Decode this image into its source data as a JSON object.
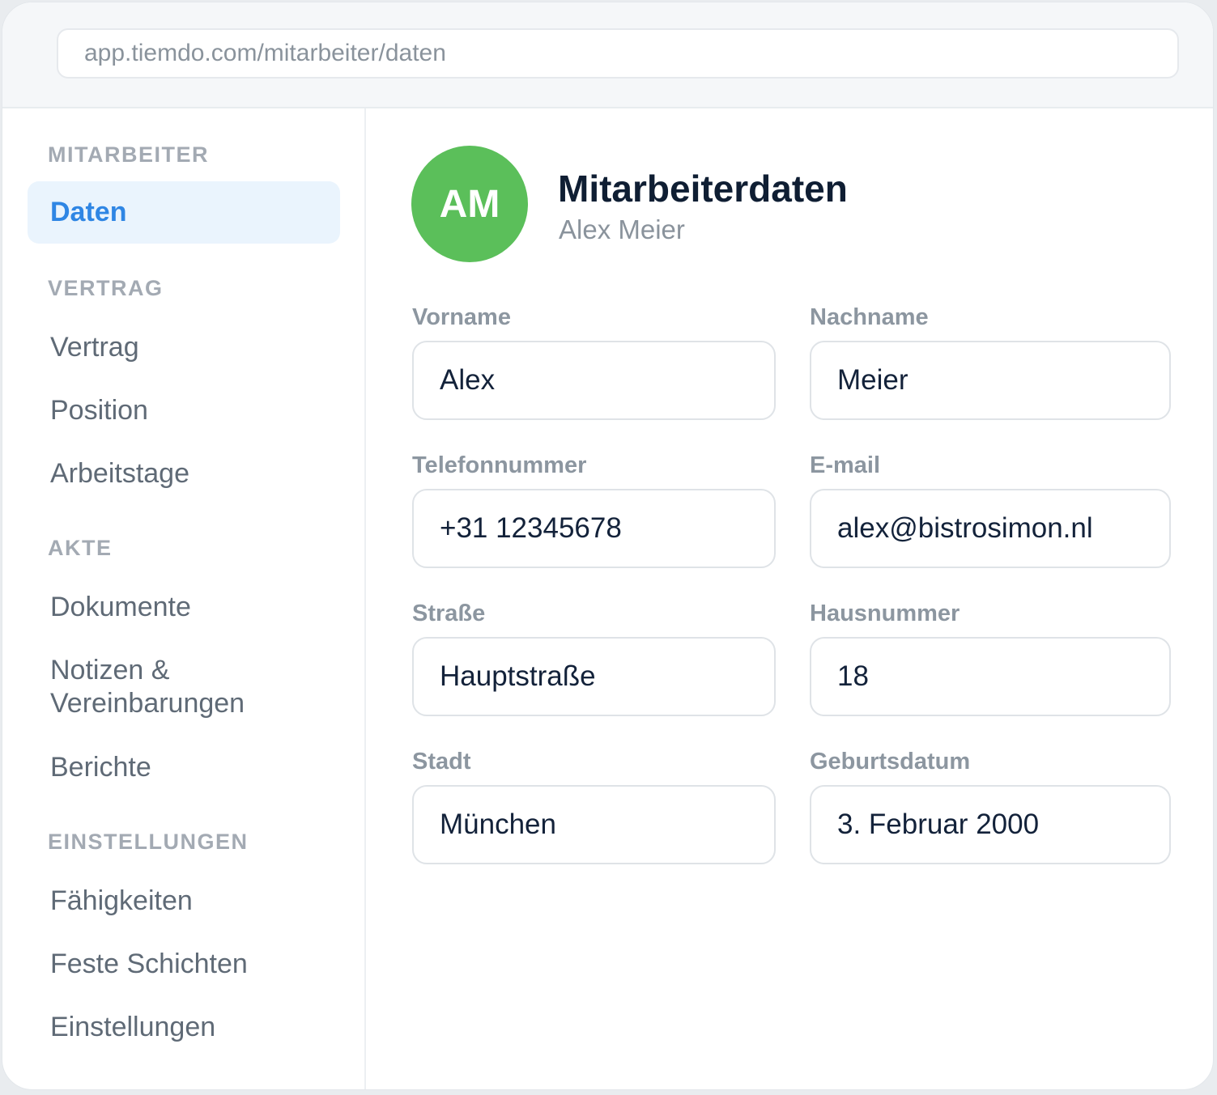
{
  "browser": {
    "url": "app.tiemdo.com/mitarbeiter/daten"
  },
  "sidebar": {
    "sections": [
      {
        "title": "MITARBEITER",
        "items": [
          {
            "label": "Daten",
            "active": true
          }
        ]
      },
      {
        "title": "VERTRAG",
        "items": [
          {
            "label": "Vertrag"
          },
          {
            "label": "Position"
          },
          {
            "label": "Arbeitstage"
          }
        ]
      },
      {
        "title": "AKTE",
        "items": [
          {
            "label": "Dokumente"
          },
          {
            "label": "Notizen &\nVereinbarungen"
          },
          {
            "label": "Berichte"
          }
        ]
      },
      {
        "title": "EINSTELLUNGEN",
        "items": [
          {
            "label": "Fähigkeiten"
          },
          {
            "label": "Feste Schichten"
          },
          {
            "label": "Einstellungen"
          }
        ]
      }
    ]
  },
  "header": {
    "avatar_initials": "AM",
    "avatar_color": "#5bbf5a",
    "title": "Mitarbeiterdaten",
    "subtitle": "Alex Meier"
  },
  "form": {
    "fields": [
      {
        "label": "Vorname",
        "value": "Alex"
      },
      {
        "label": "Nachname",
        "value": "Meier"
      },
      {
        "label": "Telefonnummer",
        "value": "+31 12345678"
      },
      {
        "label": "E-mail",
        "value": "alex@bistrosimon.nl"
      },
      {
        "label": "Straße",
        "value": "Hauptstraße"
      },
      {
        "label": "Hausnummer",
        "value": "18"
      },
      {
        "label": "Stadt",
        "value": "München"
      },
      {
        "label": "Geburtsdatum",
        "value": "3. Februar 2000"
      }
    ]
  },
  "colors": {
    "accent": "#2f86e4",
    "active_bg": "#eaf4fd"
  }
}
